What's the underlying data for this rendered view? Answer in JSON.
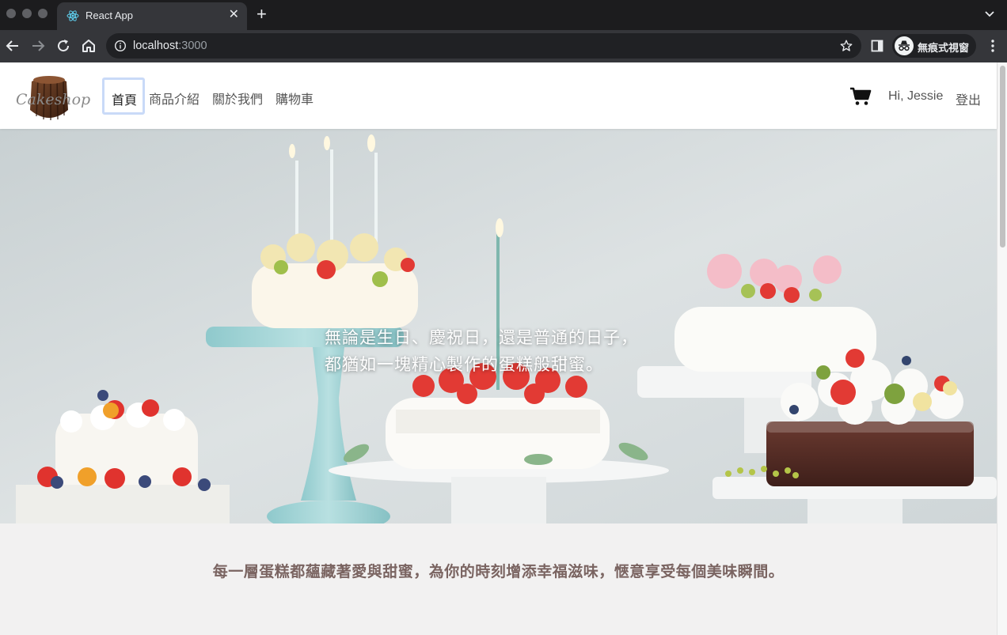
{
  "browser": {
    "tab_title": "React App",
    "url_host": "localhost",
    "url_port": ":3000",
    "profile_label": "無痕式視窗",
    "colors": {
      "frame": "#1c1c1e",
      "toolbar": "#35363a",
      "omnibox": "#202124"
    }
  },
  "navbar": {
    "logo_text": "Cakeshop",
    "items": [
      {
        "label": "首頁",
        "active": true
      },
      {
        "label": "商品介紹"
      },
      {
        "label": "關於我們"
      },
      {
        "label": "購物車"
      }
    ],
    "cart_icon": "cart-icon",
    "greeting": "Hi, Jessie",
    "logout_label": "登出"
  },
  "hero": {
    "line1": "無論是生日、慶祝日，還是普通的日子，",
    "line2": "都猶如一塊精心製作的蛋糕般甜蜜。"
  },
  "tagline": "每一層蛋糕都蘊藏著愛與甜蜜，為你的時刻增添幸福滋味，愜意享受每個美味瞬間。",
  "colors": {
    "tagline": "#7a6461",
    "page_bg": "#f2f1f1",
    "active_outline": "#c9daf8"
  }
}
